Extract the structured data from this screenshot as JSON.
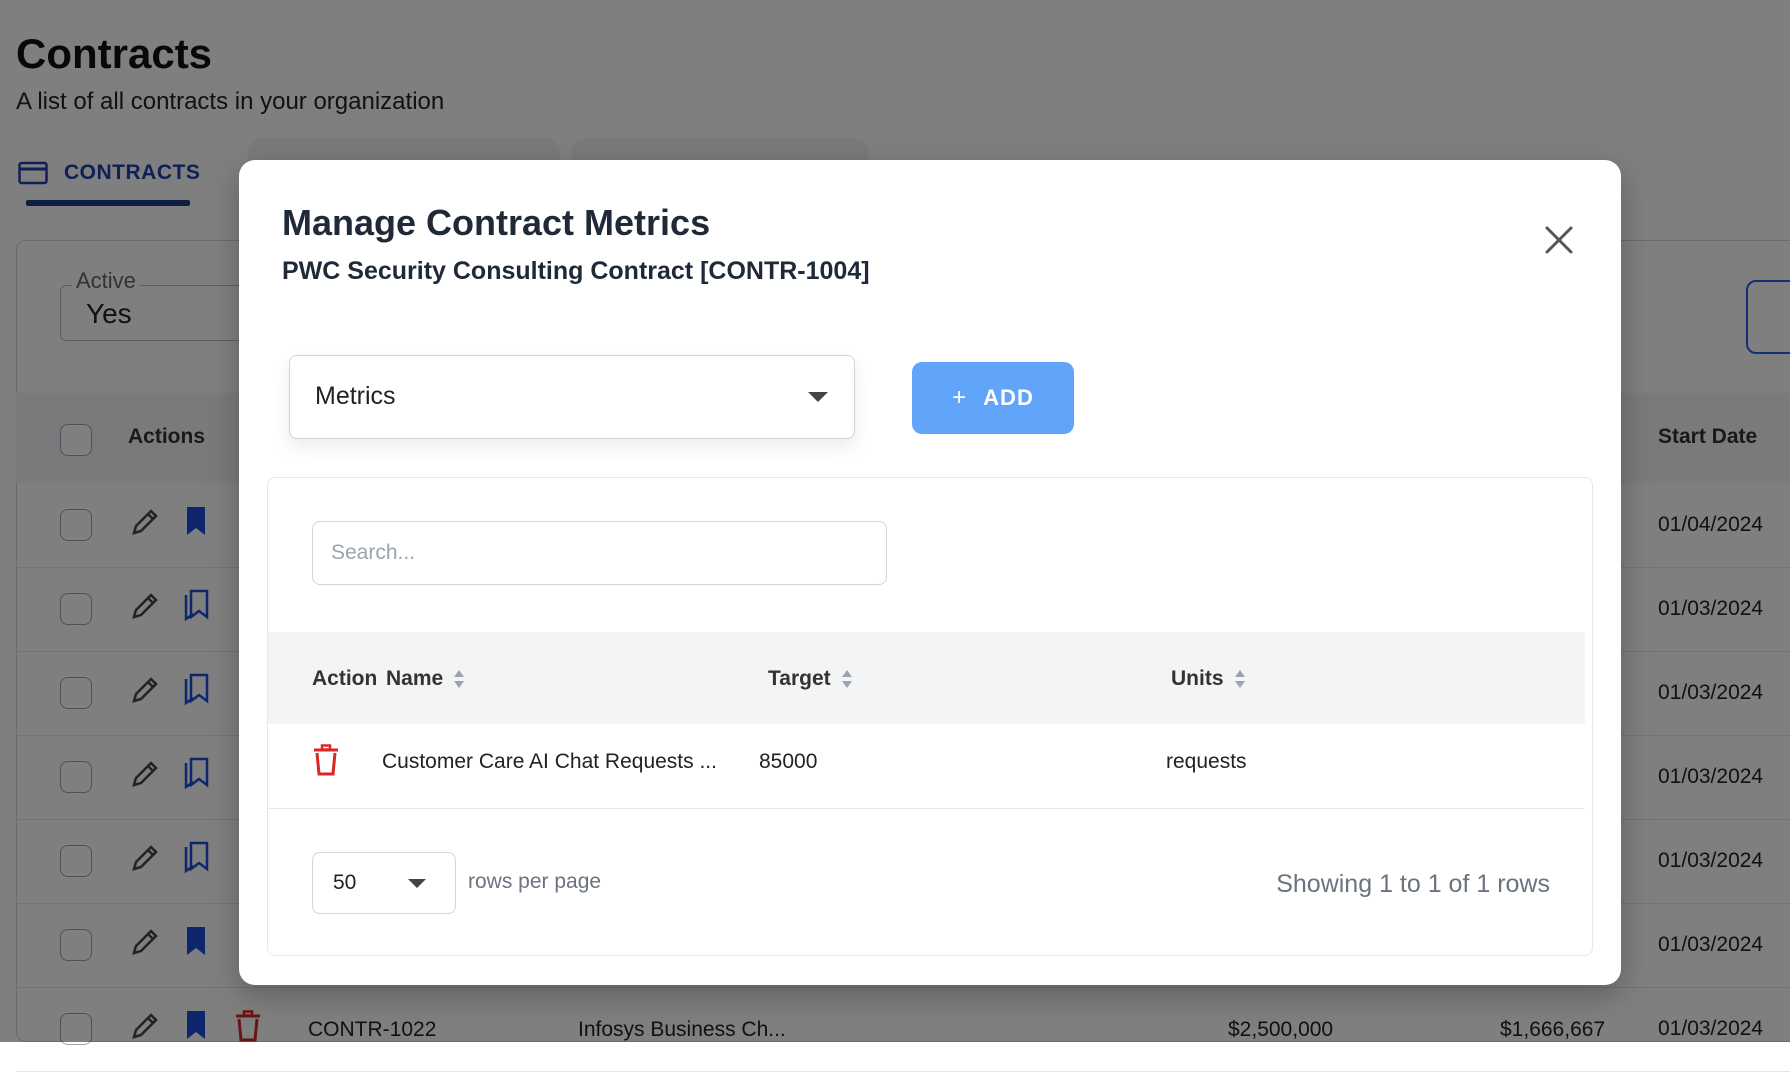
{
  "page": {
    "title": "Contracts",
    "subtitle": "A list of all contracts in your organization"
  },
  "tabs": {
    "contracts_label": "CONTRACTS"
  },
  "filter": {
    "active_label": "Active",
    "active_value": "Yes"
  },
  "background_table": {
    "actions_label": "Actions",
    "start_date_label": "Start Date",
    "dates": [
      "01/04/2024",
      "01/03/2024",
      "01/03/2024",
      "01/03/2024",
      "01/03/2024",
      "01/03/2024",
      "01/03/2024"
    ],
    "last_row": {
      "id": "CONTR-1022",
      "name": "Infosys Business Ch...",
      "value": "$2,500,000",
      "amount": "$1,666,667"
    }
  },
  "modal": {
    "title": "Manage Contract Metrics",
    "subtitle": "PWC Security Consulting Contract [CONTR-1004]",
    "metric_select_label": "Metrics",
    "add_label": "ADD",
    "search_placeholder": "Search...",
    "columns": {
      "action": "Action",
      "name": "Name",
      "target": "Target",
      "units": "Units"
    },
    "rows": [
      {
        "name": "Customer Care AI Chat Requests ...",
        "target": "85000",
        "units": "requests"
      }
    ],
    "rows_per_page_value": "50",
    "rows_per_page_label": "rows per page",
    "showing_text": "Showing 1 to 1 of 1 rows"
  },
  "colors": {
    "accent": "#1e40af",
    "add_button": "#60a5fa",
    "delete": "#dc2626",
    "bookmark": "#1d4ed8"
  }
}
